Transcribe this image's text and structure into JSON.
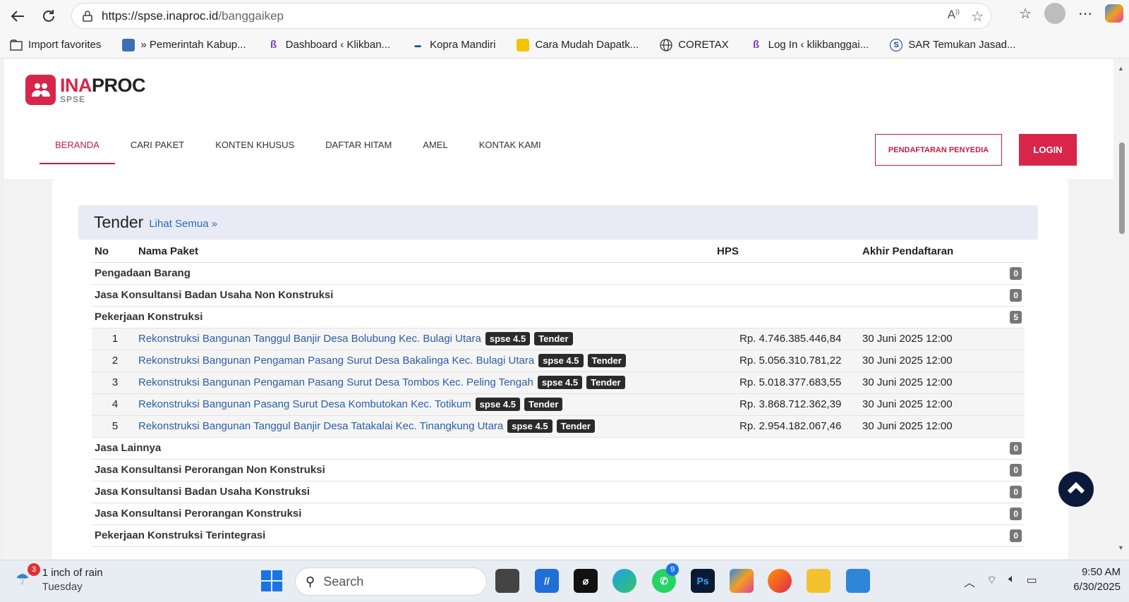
{
  "browser": {
    "url_host": "https://spse.inaproc.id",
    "url_path": "/banggaikep",
    "bookmarks": [
      {
        "label": "Import favorites",
        "icon": "import-icon"
      },
      {
        "label": "» Pemerintah Kabup...",
        "icon": "site-icon"
      },
      {
        "label": "Dashboard ‹ Klikban...",
        "icon": "site-icon"
      },
      {
        "label": "Kopra Mandiri",
        "icon": "site-icon"
      },
      {
        "label": "Cara Mudah Dapatk...",
        "icon": "site-icon"
      },
      {
        "label": "CORETAX",
        "icon": "globe-icon"
      },
      {
        "label": "Log In ‹ klikbanggai...",
        "icon": "site-icon"
      },
      {
        "label": "SAR Temukan Jasad...",
        "icon": "site-icon"
      }
    ]
  },
  "header": {
    "logo_ina": "INA",
    "logo_proc": "PROC",
    "logo_sub": "SPSE",
    "menu": [
      "BERANDA",
      "CARI PAKET",
      "KONTEN KHUSUS",
      "DAFTAR HITAM",
      "AMEL",
      "KONTAK KAMI"
    ],
    "register_label": "PENDAFTARAN PENYEDIA",
    "login_label": "LOGIN"
  },
  "tender": {
    "title": "Tender",
    "see_all": "Lihat Semua »",
    "columns": {
      "no": "No",
      "name": "Nama Paket",
      "hps": "HPS",
      "deadline": "Akhir Pendaftaran"
    },
    "categories_before": [
      {
        "name": "Pengadaan Barang",
        "count": "0"
      },
      {
        "name": "Jasa Konsultansi Badan Usaha Non Konstruksi",
        "count": "0"
      },
      {
        "name": "Pekerjaan Konstruksi",
        "count": "5"
      }
    ],
    "items": [
      {
        "no": "1",
        "name": "Rekonstruksi Bangunan Tanggul Banjir Desa Bolubung Kec. Bulagi Utara",
        "version": "spse 4.5",
        "type": "Tender",
        "hps": "Rp. 4.746.385.446,84",
        "deadline": "30 Juni 2025 12:00"
      },
      {
        "no": "2",
        "name": "Rekonstruksi Bangunan Pengaman Pasang Surut Desa Bakalinga Kec. Bulagi Utara",
        "version": "spse 4.5",
        "type": "Tender",
        "hps": "Rp. 5.056.310.781,22",
        "deadline": "30 Juni 2025 12:00"
      },
      {
        "no": "3",
        "name": "Rekonstruksi Bangunan Pengaman Pasang Surut Desa Tombos Kec. Peling Tengah",
        "version": "spse 4.5",
        "type": "Tender",
        "hps": "Rp. 5.018.377.683,55",
        "deadline": "30 Juni 2025 12:00"
      },
      {
        "no": "4",
        "name": "Rekonstruksi Bangunan Pasang Surut Desa Kombutokan Kec. Totikum",
        "version": "spse 4.5",
        "type": "Tender",
        "hps": "Rp. 3.868.712.362,39",
        "deadline": "30 Juni 2025 12:00"
      },
      {
        "no": "5",
        "name": "Rekonstruksi Bangunan Tanggul Banjir Desa Tatakalai Kec. Tinangkung Utara",
        "version": "spse 4.5",
        "type": "Tender",
        "hps": "Rp. 2.954.182.067,46",
        "deadline": "30 Juni 2025 12:00"
      }
    ],
    "categories_after": [
      {
        "name": "Jasa Lainnya",
        "count": "0"
      },
      {
        "name": "Jasa Konsultansi Perorangan Non Konstruksi",
        "count": "0"
      },
      {
        "name": "Jasa Konsultansi Badan Usaha Konstruksi",
        "count": "0"
      },
      {
        "name": "Jasa Konsultansi Perorangan Konstruksi",
        "count": "0"
      },
      {
        "name": "Pekerjaan Konstruksi Terintegrasi",
        "count": "0"
      }
    ]
  },
  "taskbar": {
    "weather_badge": "3",
    "weather_text": "1 inch of rain",
    "weather_day": "Tuesday",
    "search_placeholder": "Search",
    "whatsapp_badge": "9",
    "time": "9:50 AM",
    "date": "6/30/2025"
  },
  "colors": {
    "brand": "#d8264a",
    "link": "#2a5ea8",
    "badge": "#2b2b2b"
  }
}
